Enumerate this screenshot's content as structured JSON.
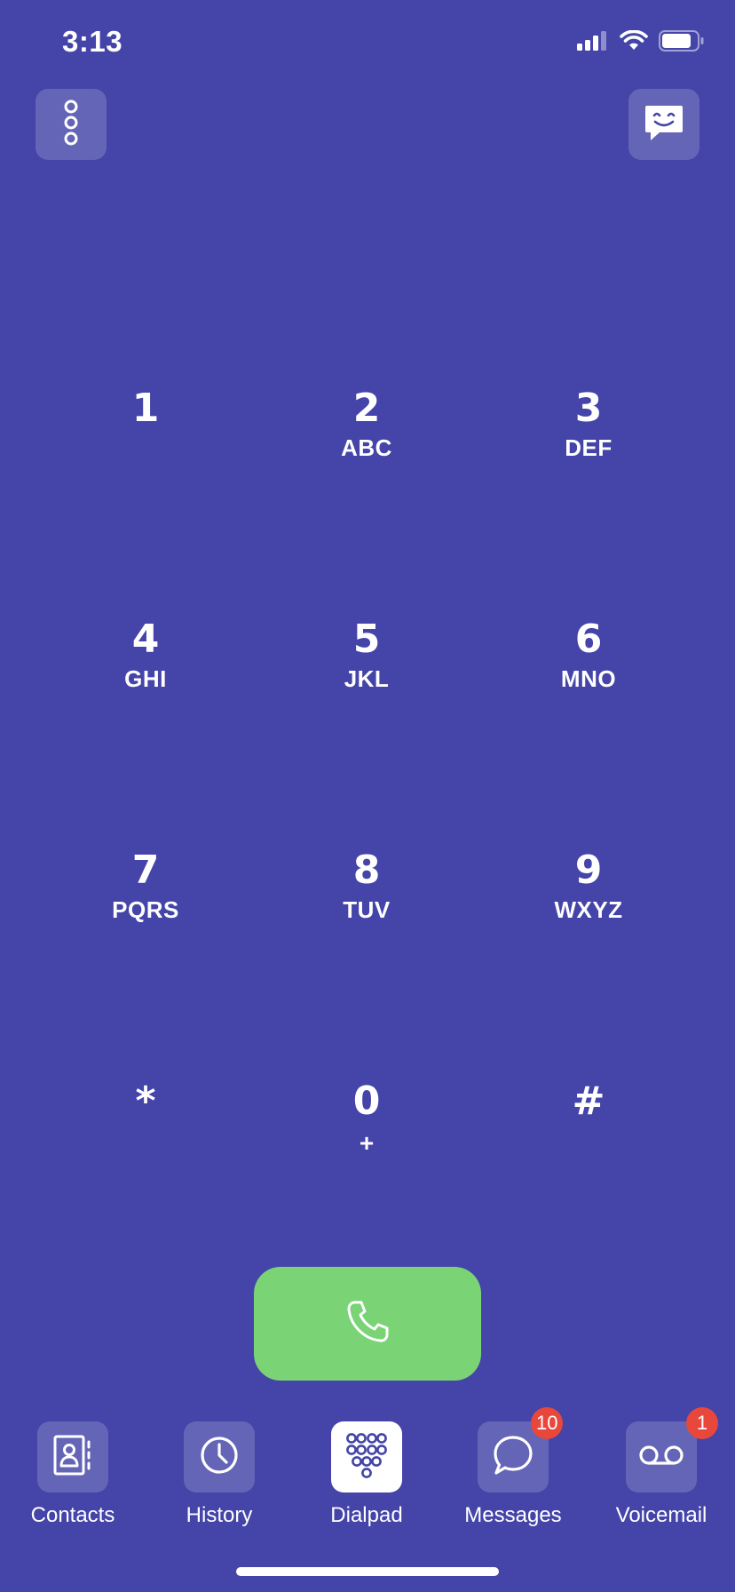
{
  "status_bar": {
    "time": "3:13",
    "icons": [
      "cellular-signal-icon",
      "wifi-icon",
      "battery-icon"
    ]
  },
  "top_bar": {
    "menu_icon": "vertical-dots-icon",
    "chat_icon": "smiley-chat-icon"
  },
  "keypad": {
    "keys": [
      {
        "digit": "1",
        "letters": ""
      },
      {
        "digit": "2",
        "letters": "ABC"
      },
      {
        "digit": "3",
        "letters": "DEF"
      },
      {
        "digit": "4",
        "letters": "GHI"
      },
      {
        "digit": "5",
        "letters": "JKL"
      },
      {
        "digit": "6",
        "letters": "MNO"
      },
      {
        "digit": "7",
        "letters": "PQRS"
      },
      {
        "digit": "8",
        "letters": "TUV"
      },
      {
        "digit": "9",
        "letters": "WXYZ"
      },
      {
        "digit": "*",
        "letters": ""
      },
      {
        "digit": "0",
        "letters": "+"
      },
      {
        "digit": "#",
        "letters": ""
      }
    ]
  },
  "call_button": {
    "icon": "phone-icon",
    "color": "#7AD476"
  },
  "bottom_nav": {
    "items": [
      {
        "label": "Contacts",
        "icon": "contacts-book-icon",
        "badge": ""
      },
      {
        "label": "History",
        "icon": "clock-icon",
        "badge": ""
      },
      {
        "label": "Dialpad",
        "icon": "dialpad-icon",
        "badge": "",
        "active": true
      },
      {
        "label": "Messages",
        "icon": "speech-bubble-icon",
        "badge": "10"
      },
      {
        "label": "Voicemail",
        "icon": "voicemail-icon",
        "badge": "1"
      }
    ]
  },
  "colors": {
    "background": "#4444A9",
    "badge": "#E8473B",
    "call": "#7AD476"
  }
}
